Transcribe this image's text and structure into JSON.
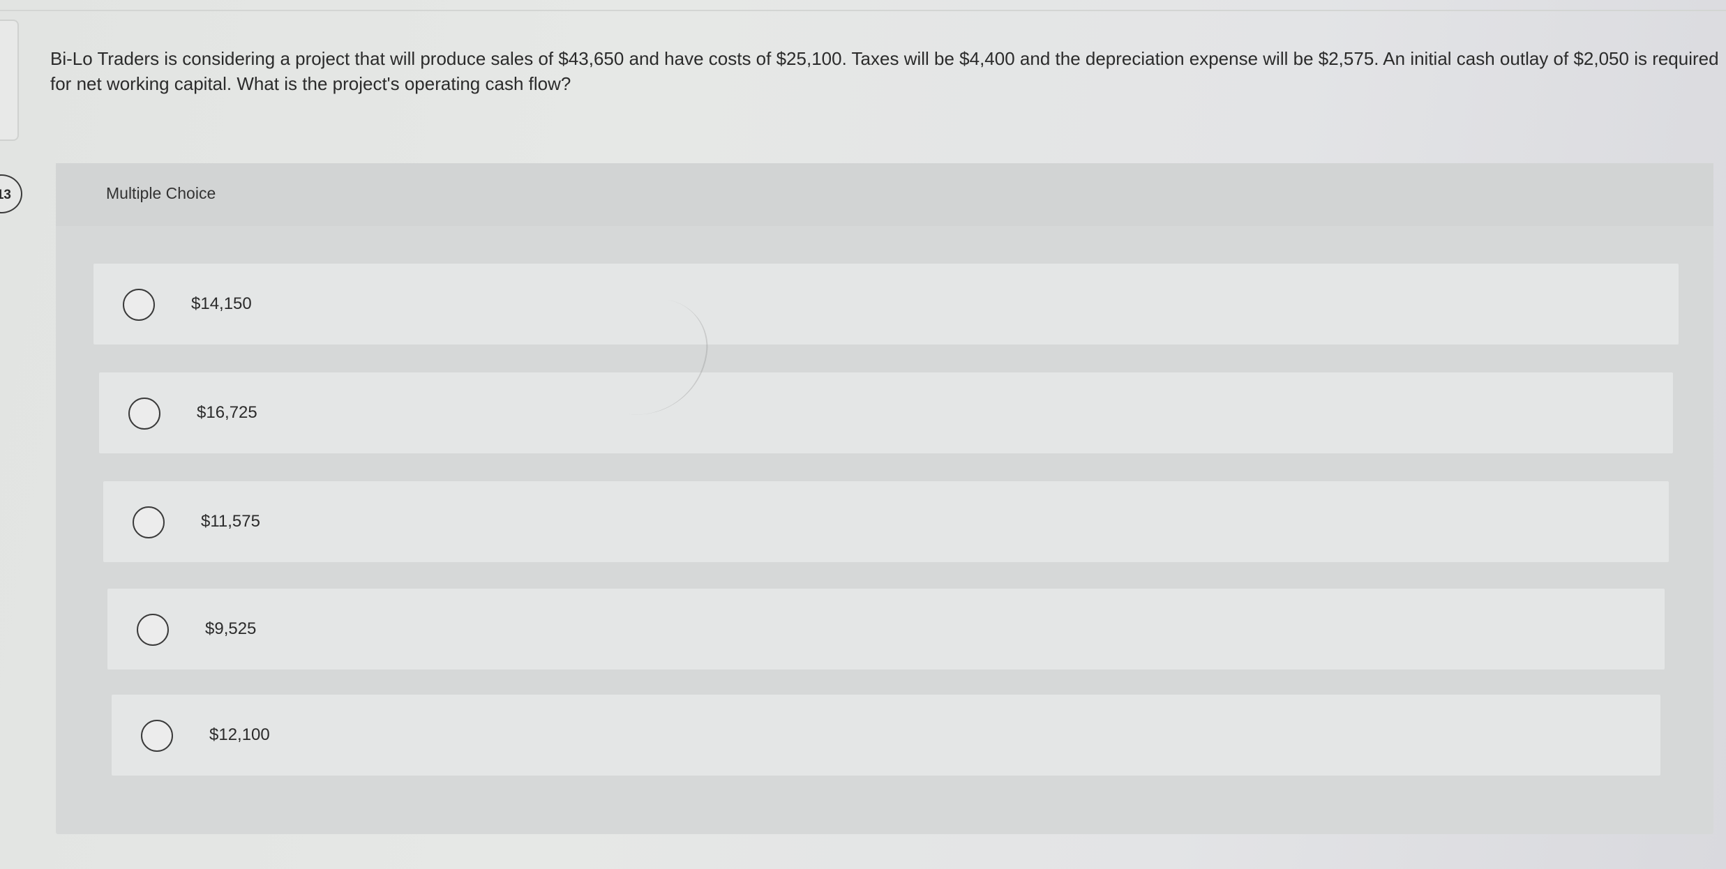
{
  "question": {
    "number": "13",
    "text": "Bi-Lo Traders is considering a project that will produce sales of $43,650 and have costs of $25,100. Taxes will be $4,400 and the depreciation expense will be $2,575. An initial cash outlay of $2,050 is required for net working capital. What is the project's operating cash flow?"
  },
  "choices": {
    "header": "Multiple Choice",
    "options": [
      {
        "label": "$14,150"
      },
      {
        "label": "$16,725"
      },
      {
        "label": "$11,575"
      },
      {
        "label": "$9,525"
      },
      {
        "label": "$12,100"
      }
    ]
  }
}
